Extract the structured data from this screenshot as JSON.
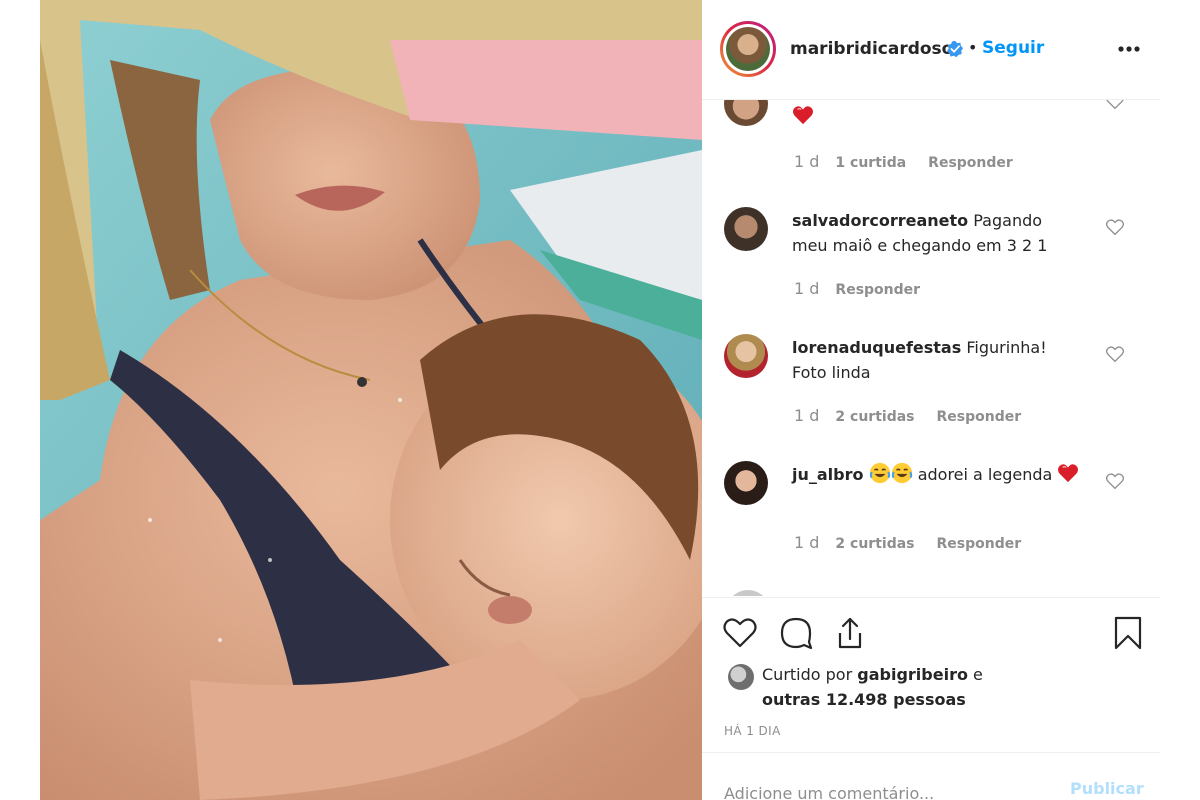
{
  "header": {
    "username": "maribridicardoso",
    "separator": "•",
    "follow_label": "Seguir"
  },
  "comments": [
    {
      "username": "",
      "text": "",
      "emoji_after": "red-heart",
      "time": "1 d",
      "likes": "1 curtida",
      "reply_label": "Responder"
    },
    {
      "username": "salvadorcorreaneto",
      "text": "Pagando meu maiô e chegando em 3 2 1",
      "time": "1 d",
      "likes": "",
      "reply_label": "Responder"
    },
    {
      "username": "lorenaduquefestas",
      "text": "Figurinha! Foto linda",
      "time": "1 d",
      "likes": "2 curtidas",
      "reply_label": "Responder"
    },
    {
      "username": "ju_albro",
      "text": "adorei a legenda",
      "emoji_before": [
        "face-with-tears-of-joy",
        "face-with-tears-of-joy"
      ],
      "emoji_after": "red-heart",
      "time": "1 d",
      "likes": "2 curtidas",
      "reply_label": "Responder"
    }
  ],
  "likes_summary": {
    "prefix": "Curtido por",
    "user": "gabigribeiro",
    "middle": "e",
    "others": "outras 12.498 pessoas"
  },
  "timestamp": "HÁ 1 DIA",
  "add_comment": {
    "placeholder": "Adicione um comentário...",
    "publish_label": "Publicar"
  },
  "colors": {
    "accent": "#0095f6",
    "publish_disabled": "#b2dffc",
    "muted_text": "#8e8e8e",
    "border": "#efefef"
  },
  "icons": [
    "verified-badge-icon",
    "more-options-icon",
    "heart-outline-icon",
    "comment-icon",
    "share-icon",
    "bookmark-icon"
  ]
}
